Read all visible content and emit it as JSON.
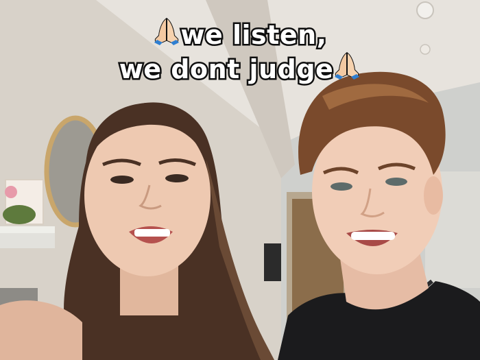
{
  "caption": {
    "line1": "we listen,",
    "line2": "we dont judge"
  },
  "icons": {
    "left": "folded-hands-icon",
    "right": "folded-hands-icon"
  },
  "colors": {
    "wall": "#d9d4cc",
    "ceiling": "#e6e2dc",
    "door": "#8a6c4a",
    "hair_left": "#4a3124",
    "hair_right": "#7a4a2c",
    "skin": "#e9c3aa",
    "shirt": "#1b1b1d",
    "caption_text": "#ffffff",
    "caption_stroke": "#111111"
  }
}
